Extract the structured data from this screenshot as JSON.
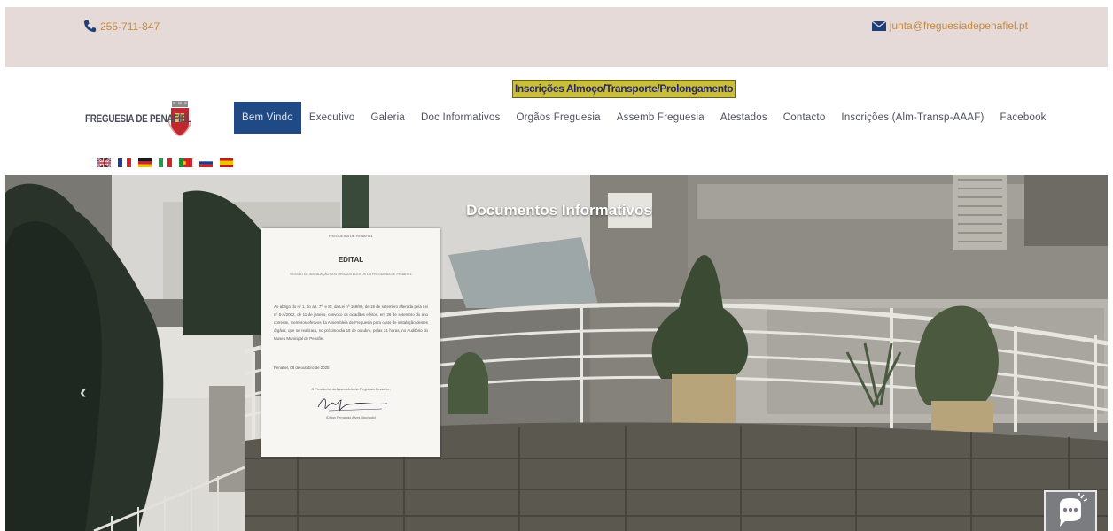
{
  "contact": {
    "phone": "255-711-847",
    "email": "junta@freguesiadepenafiel.pt"
  },
  "logo": {
    "text": "FREGUESIA DE PENAFIEL"
  },
  "banner": {
    "text": "Inscrições Almoço/Transporte/Prolongamento"
  },
  "nav": {
    "items": [
      {
        "label": "Bem Vindo",
        "active": true
      },
      {
        "label": "Executivo"
      },
      {
        "label": "Galeria"
      },
      {
        "label": "Doc Informativos"
      },
      {
        "label": "Orgãos Freguesia"
      },
      {
        "label": "Assemb Freguesia"
      },
      {
        "label": "Atestados"
      },
      {
        "label": "Contacto"
      },
      {
        "label": "Inscrições (Alm-Transp-AAAF)"
      },
      {
        "label": "Facebook"
      }
    ]
  },
  "flags": [
    "english-flag",
    "french-flag",
    "german-flag",
    "italian-flag",
    "portuguese-flag",
    "russian-flag",
    "spanish-flag"
  ],
  "hero": {
    "title": "Documentos Informativos",
    "prev": "‹",
    "next": "›"
  },
  "document": {
    "header": "FREGUESIA DE PENAFIEL",
    "title": "EDITAL",
    "subtitle": "SESSÃO DE INSTALAÇÃO DOS ÓRGÃOS ELEITOS DA FREGUESIA DE PENAFIEL",
    "body": "Ao abrigo do nº 1, do art. 7º, e 8º, da Lei nº 169/99, de 18 de setembro alterada pela Lei nº 5-A/2002, de 11 de janeiro, convoco os cidadãos eleitos, em 26 de setembro do ano corrente, membros efetivos da Assembleia de Freguesia para o ato de instalação destes órgãos, que se realizará, no próximo dia 18 de outubro, pelas 21 horas, no Auditório do Museu Municipal de Penafiel.",
    "date": "Penafiel, 08 de outubro de 2025",
    "sign_label": "O Presidente da Assembleia da Freguesia Cessante,",
    "sign_name": "(Diogo Fernando Alves Machado)"
  },
  "colors": {
    "topbar_bg": "#e5dad7",
    "contact_text": "#c98a3e",
    "nav_active_bg": "#1f4a86",
    "banner_bg": "#c9bf3a"
  }
}
